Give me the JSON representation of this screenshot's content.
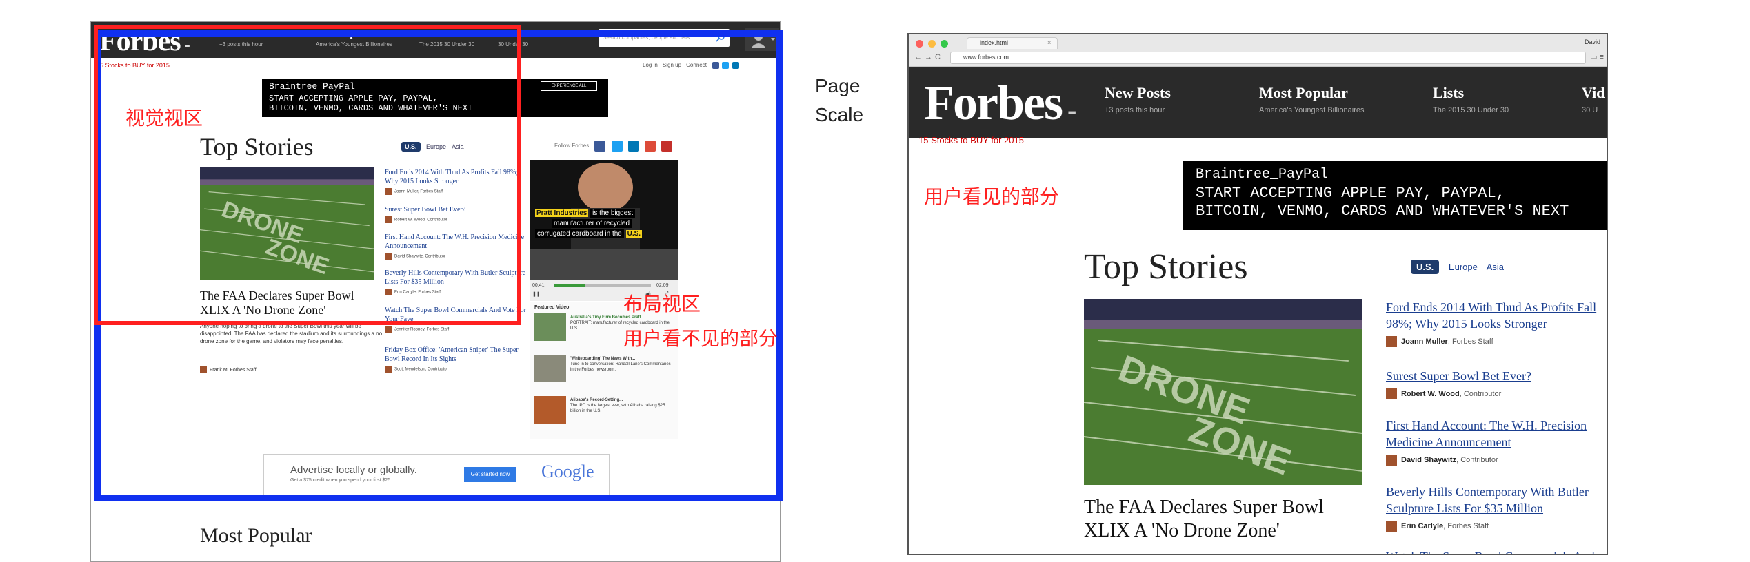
{
  "left": {
    "logo": "Forbes",
    "nav": [
      {
        "title": "New Posts",
        "sub": "+3 posts this hour"
      },
      {
        "title": "Most Popular",
        "sub": "America's Youngest Billionaires"
      },
      {
        "title": "Lists",
        "sub": "The 2015 30 Under 30"
      },
      {
        "title": "Video",
        "sub": "30 Under 30"
      }
    ],
    "search_placeholder": "Search companies, people and lists",
    "promo": "15 Stocks to BUY for 2015",
    "toplinks": "Log in · Sign up · Connect",
    "ad": {
      "brand": "Braintree_PayPal",
      "copy": "START ACCEPTING APPLE PAY, PAYPAL,\nBITCOIN, VENMO, CARDS AND WHATEVER'S NEXT",
      "button": "EXPERIENCE ALL"
    },
    "top_stories": "Top Stories",
    "regions": [
      "U.S.",
      "Europe",
      "Asia"
    ],
    "follow": "Follow Forbes",
    "lead": {
      "title": "The FAA Declares Super Bowl XLIX A 'No Drone Zone'",
      "body": "Anyone hoping to bring a drone to the Super Bowl this year will be disappointed. The FAA has declared the stadium and its surroundings a no drone zone for the game, and violators may face penalties.",
      "author": "Frank M. Forbes Staff"
    },
    "stories": [
      {
        "title": "Ford Ends 2014 With Thud As Profits Fall 98%; Why 2015 Looks Stronger",
        "author": "Joann Muller, Forbes Staff"
      },
      {
        "title": "Surest Super Bowl Bet Ever?",
        "author": "Robert W. Wood, Contributor"
      },
      {
        "title": "First Hand Account: The W.H. Precision Medicine Announcement",
        "author": "David Shaywitz, Contributor"
      },
      {
        "title": "Beverly Hills Contemporary With Butler Sculpture Lists For $35 Million",
        "author": "Erin Carlyle, Forbes Staff"
      },
      {
        "title": "Watch The Super Bowl Commercials And Vote For Your Fave",
        "author": "Jennifer Rooney, Forbes Staff"
      },
      {
        "title": "Friday Box Office: 'American Sniper' The Super Bowl Record In Its Sights",
        "author": "Scott Mendelson, Contributor"
      }
    ],
    "video": {
      "caption_1": "Pratt Industries",
      "caption_2": "is the biggest",
      "caption_3": "manufacturer of recycled",
      "caption_4": "corrugated cardboard in the",
      "caption_5": "U.S.",
      "time_start": "00:41",
      "time_end": "02:09",
      "featured_label": "Featured Video",
      "featured": [
        {
          "title": "Australia's Tiny Firm Becomes Pratt",
          "body": "PORTRAIT: manufacturer of recycled cardboard in the U.S."
        },
        {
          "title": "'Whiteboarding' The News With...",
          "body": "Tune in to conversation: Randall Lane's Commentaries in the Forbes newsroom."
        },
        {
          "title": "Alibaba's Record-Setting...",
          "body": "The IPO is the largest ever, with Alibaba raising $25 billion in the U.S."
        }
      ]
    },
    "google_ad": {
      "text": "Advertise locally or globally.",
      "sub": "Get a $75 credit when you spend your first $25",
      "button": "Get started now",
      "logo": "Google"
    },
    "most_popular": "Most Popular"
  },
  "annotations": {
    "visual_viewport": "视觉视区",
    "layout_viewport": "布局视区",
    "unseen_part": "用户看不见的部分",
    "seen_part": "用户看见的部分",
    "red_color": "#ff2020",
    "blue_color": "#1030f0"
  },
  "scale_label_1": "Page",
  "scale_label_2": "Scale",
  "right": {
    "tab_title": "index.html",
    "tab_close": "×",
    "user": "David",
    "url": "www.forbes.com",
    "logo": "Forbes",
    "nav": [
      {
        "title": "New Posts",
        "sub": "+3 posts this hour"
      },
      {
        "title": "Most Popular",
        "sub": "America's Youngest Billionaires"
      },
      {
        "title": "Lists",
        "sub": "The 2015 30 Under 30"
      },
      {
        "title": "Vid",
        "sub": "30 U"
      }
    ],
    "promo": "15 Stocks to BUY for 2015",
    "ad": {
      "brand": "Braintree_PayPal",
      "copy": "START ACCEPTING APPLE PAY, PAYPAL,\nBITCOIN, VENMO, CARDS AND WHATEVER'S NEXT"
    },
    "top_stories": "Top Stories",
    "regions": [
      "U.S.",
      "Europe",
      "Asia"
    ],
    "lead_title": "The FAA Declares Super Bowl XLIX A 'No Drone Zone'",
    "stories": [
      {
        "title": "Ford Ends 2014 With Thud As Profits Fall 98%; Why 2015 Looks Stronger",
        "author": "Joann Muller",
        "role": ", Forbes Staff"
      },
      {
        "title": "Surest Super Bowl Bet Ever?",
        "author": "Robert W. Wood",
        "role": ", Contributor"
      },
      {
        "title": "First Hand Account: The W.H. Precision Medicine Announcement",
        "author": "David Shaywitz",
        "role": ", Contributor"
      },
      {
        "title": "Beverly Hills Contemporary With Butler Sculpture Lists For $35 Million",
        "author": "Erin Carlyle",
        "role": ", Forbes Staff"
      },
      {
        "title": "Watch The Super Bowl Commercials And",
        "author": "",
        "role": ""
      }
    ]
  }
}
